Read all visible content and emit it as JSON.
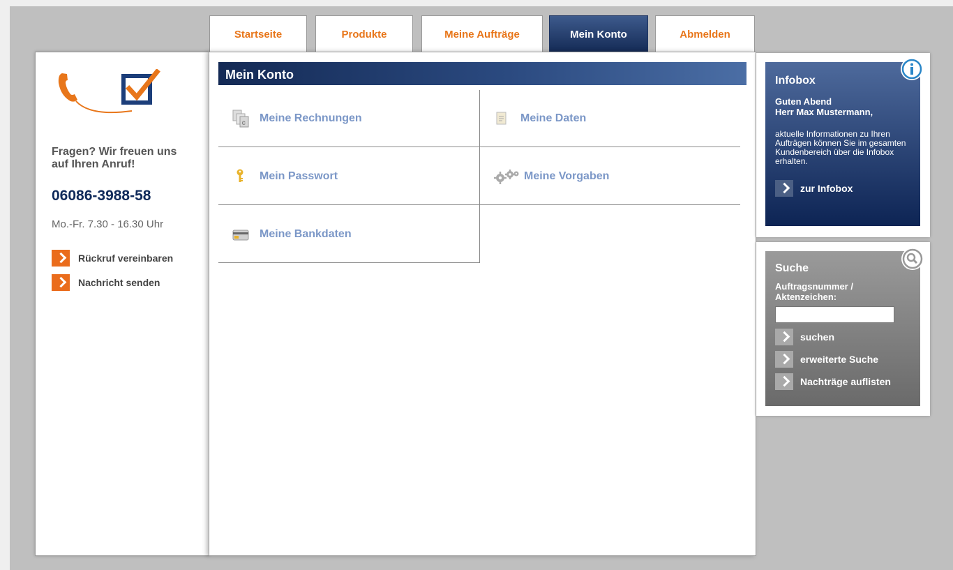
{
  "tabs": [
    {
      "label": "Startseite"
    },
    {
      "label": "Produkte"
    },
    {
      "label": "Meine Aufträge"
    },
    {
      "label": "Mein Konto",
      "active": true
    },
    {
      "label": "Abmelden"
    }
  ],
  "sidebar": {
    "question": "Fragen? Wir freuen uns auf Ihren Anruf!",
    "phone": "06086-3988-58",
    "hours": "Mo.-Fr. 7.30 - 16.30 Uhr",
    "links": [
      {
        "label": "Rückruf vereinbaren"
      },
      {
        "label": "Nachricht senden"
      }
    ]
  },
  "main": {
    "title": "Mein Konto",
    "items": [
      {
        "label": "Meine Rechnungen",
        "icon": "invoice-icon"
      },
      {
        "label": "Meine Daten",
        "icon": "document-icon"
      },
      {
        "label": "Mein Passwort",
        "icon": "key-icon"
      },
      {
        "label": "Meine Vorgaben",
        "icon": "gears-icon"
      },
      {
        "label": "Meine Bankdaten",
        "icon": "bank-card-icon"
      }
    ]
  },
  "infobox": {
    "title": "Infobox",
    "greeting_line1": "Guten Abend",
    "greeting_line2": "Herr Max Mustermann,",
    "text": "aktuelle Informationen zu Ihren Aufträgen können Sie im gesamten Kundenbereich über die Infobox erhalten.",
    "link": "zur Infobox"
  },
  "search": {
    "title": "Suche",
    "label_line1": "Auftragsnummer /",
    "label_line2": "Aktenzeichen:",
    "input_value": "",
    "links": [
      {
        "label": "suchen"
      },
      {
        "label": "erweiterte Suche"
      },
      {
        "label": "Nachträge auflisten"
      }
    ]
  },
  "colors": {
    "accent_orange": "#e8761a",
    "navy": "#142a55",
    "link_blue": "#7b97c7"
  }
}
